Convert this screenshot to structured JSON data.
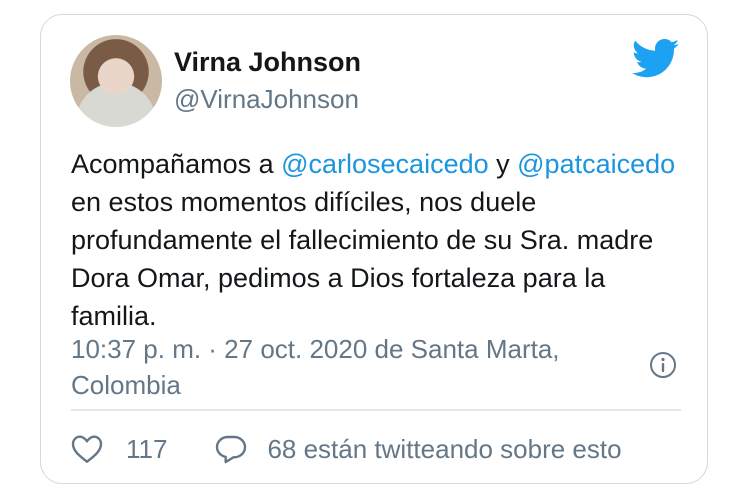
{
  "author": {
    "name": "Virna Johnson",
    "handle": "@VirnaJohnson"
  },
  "tweet": {
    "part1": "Acompañamos a ",
    "mention1": "@carlosecaicedo",
    "part2": " y ",
    "mention2": "@patcaicedo",
    "part3": " en estos momentos difíciles, nos duele profundamente el fallecimiento de su Sra. madre Dora Omar, pedimos a Dios fortaleza para la familia."
  },
  "meta": {
    "timestamp_location": "10:37 p. m. · 27 oct. 2020 de Santa Marta, Colombia"
  },
  "actions": {
    "likes": "117",
    "replies_label": "68 están twitteando sobre esto"
  },
  "colors": {
    "brand": "#1da1f2",
    "mention": "#1b95e0",
    "secondary_text": "#657786",
    "border": "#cfd9de"
  },
  "icons": [
    "twitter-bird-icon",
    "info-icon",
    "heart-icon",
    "reply-bubble-icon"
  ]
}
